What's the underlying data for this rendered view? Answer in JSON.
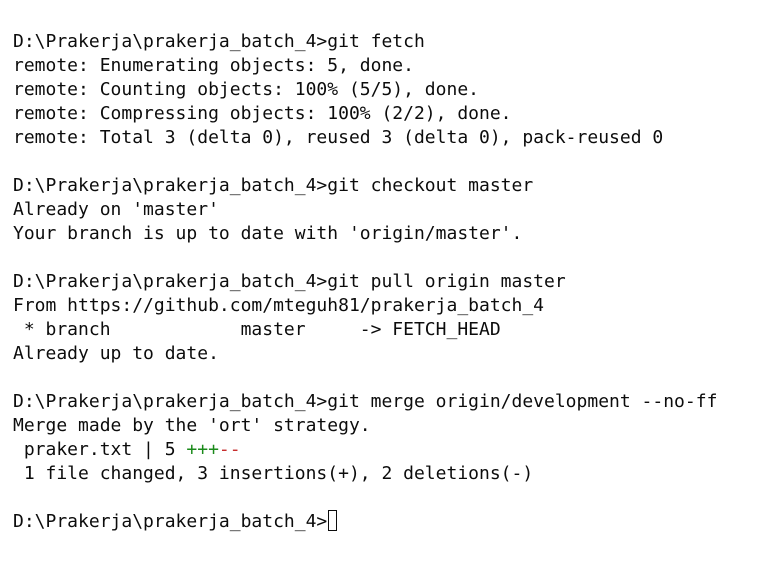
{
  "terminal": {
    "lines": [
      "D:\\Prakerja\\prakerja_batch_4>git fetch",
      "remote: Enumerating objects: 5, done.",
      "remote: Counting objects: 100% (5/5), done.",
      "remote: Compressing objects: 100% (2/2), done.",
      "remote: Total 3 (delta 0), reused 3 (delta 0), pack-reused 0",
      "",
      "D:\\Prakerja\\prakerja_batch_4>git checkout master",
      "Already on 'master'",
      "Your branch is up to date with 'origin/master'.",
      "",
      "D:\\Prakerja\\prakerja_batch_4>git pull origin master",
      "From https://github.com/mteguh81/prakerja_batch_4",
      " * branch            master     -> FETCH_HEAD",
      "Already up to date.",
      "",
      "D:\\Prakerja\\prakerja_batch_4>git merge origin/development --no-ff",
      "Merge made by the 'ort' strategy.",
      " praker.txt | 5 ",
      " 1 file changed, 3 insertions(+), 2 deletions(-)",
      ""
    ],
    "diffstat_plus": "+++",
    "diffstat_minus": "--",
    "prompt": "D:\\Prakerja\\prakerja_batch_4>",
    "colors": {
      "background": "#ffffff",
      "text": "#0c0c0c",
      "insertions": "#1a8a1a",
      "deletions": "#c72e2e"
    }
  }
}
